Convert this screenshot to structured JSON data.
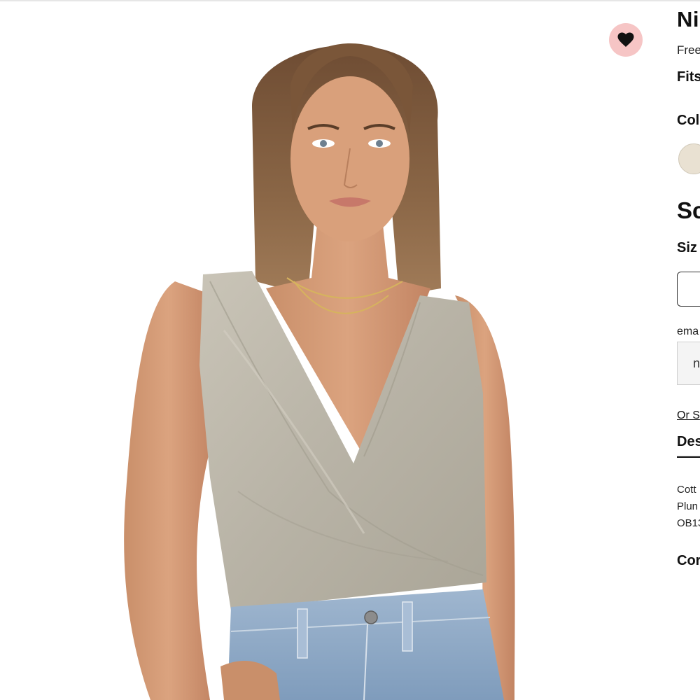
{
  "product": {
    "name_visible": "Ni",
    "brand_visible": "Free",
    "fits_label_visible": "Fits"
  },
  "color": {
    "label_visible": "Col",
    "swatch_color": "#e9e1d2"
  },
  "size": {
    "select_heading_visible": "Sc",
    "label_visible": "Siz"
  },
  "email": {
    "label_visible": "ema",
    "input_value_visible": "n"
  },
  "links": {
    "or_link_visible": "Or S"
  },
  "tabs": {
    "description_visible": "Des"
  },
  "description": {
    "lines": [
      "Cott",
      "Plun",
      "OB13"
    ]
  },
  "contact_visible": "Cor",
  "favorite": {
    "icon": "heart-icon",
    "bg_color": "#f6c5c5",
    "icon_color": "#111111"
  }
}
